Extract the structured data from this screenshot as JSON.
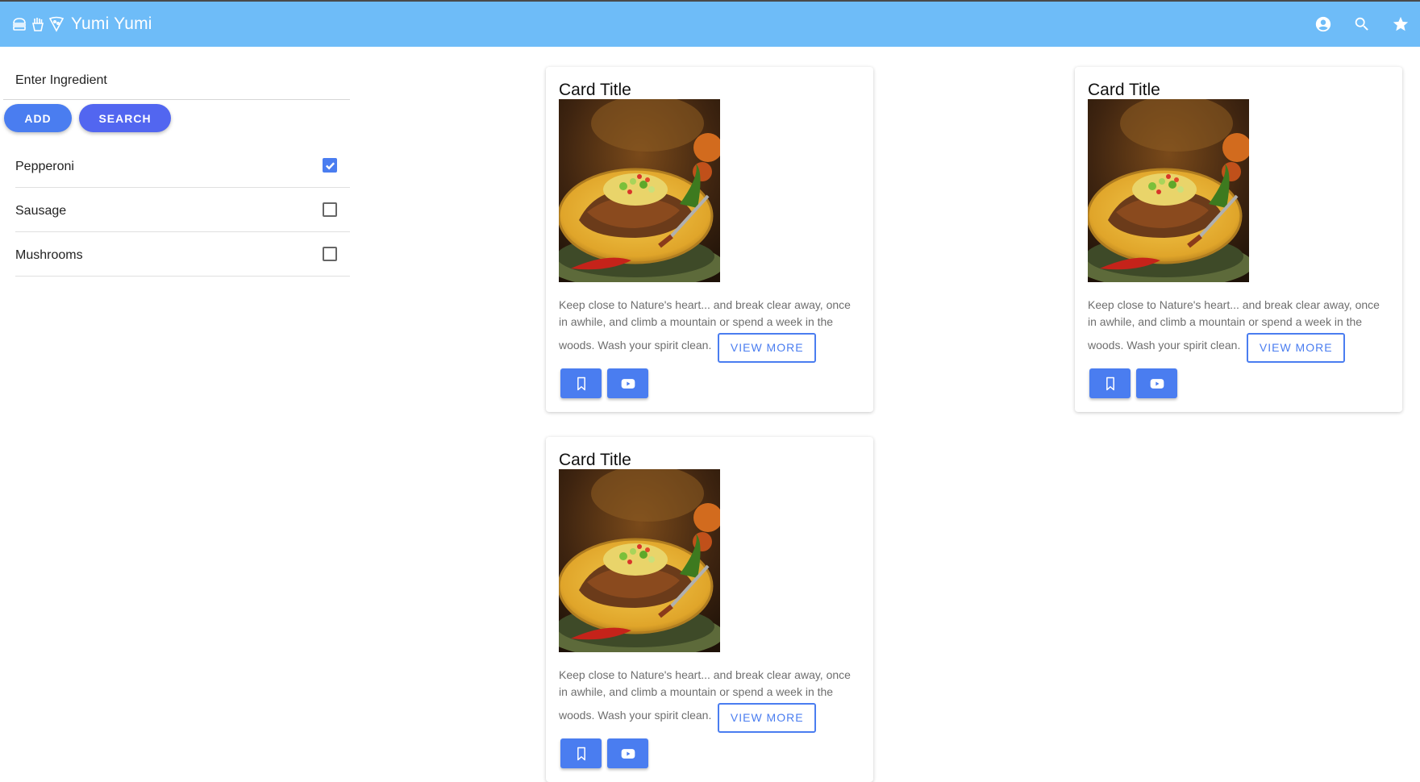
{
  "app": {
    "title": "Yumi Yumi"
  },
  "header": {
    "icons": [
      "burger-icon",
      "fries-icon",
      "pizza-icon"
    ],
    "actions": [
      "account-circle-icon",
      "search-icon",
      "star-icon"
    ]
  },
  "sidebar": {
    "ingredient_placeholder": "Enter Ingredient",
    "add_label": "ADD",
    "search_label": "SEARCH",
    "ingredients": [
      {
        "label": "Pepperoni",
        "checked": true
      },
      {
        "label": "Sausage",
        "checked": false
      },
      {
        "label": "Mushrooms",
        "checked": false
      }
    ]
  },
  "cards": [
    {
      "title": "Card Title",
      "description": "Keep close to Nature's heart... and break clear away, once in awhile, and climb a mountain or spend a week in the woods. Wash your spirit clean.",
      "view_more": "VIEW MORE"
    },
    {
      "title": "Card Title",
      "description": "Keep close to Nature's heart... and break clear away, once in awhile, and climb a mountain or spend a week in the woods. Wash your spirit clean.",
      "view_more": "VIEW MORE"
    },
    {
      "title": "Card Title",
      "description": "Keep close to Nature's heart... and break clear away, once in awhile, and climb a mountain or spend a week in the woods. Wash your spirit clean.",
      "view_more": "VIEW MORE"
    }
  ],
  "colors": {
    "header": "#6ebcf8",
    "primary": "#4a7df0",
    "search_button": "#5266f0"
  }
}
